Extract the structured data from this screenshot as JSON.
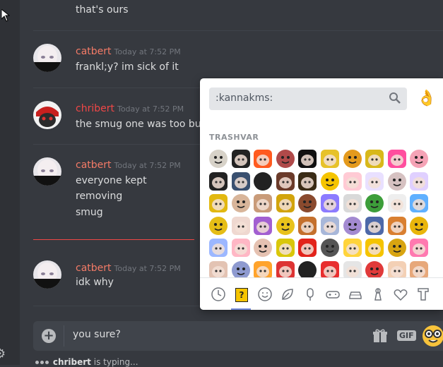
{
  "messages": [
    {
      "author": "",
      "time": "",
      "lines": [
        "that's ours"
      ]
    },
    {
      "author": "catbert",
      "time": "Today at 7:52 PM",
      "lines": [
        "frankl;y? im sick of it"
      ]
    },
    {
      "author": "chribert",
      "time": "Today at 7:52 PM",
      "lines": [
        "the smug one was too but it"
      ]
    },
    {
      "author": "catbert",
      "time": "Today at 7:52 PM",
      "lines": [
        "everyone kept",
        "removing",
        "smug"
      ]
    },
    {
      "author": "catbert",
      "time": "Today at 7:52 PM",
      "lines": [
        "idk why"
      ]
    }
  ],
  "composer": {
    "value": "you sure?",
    "gif_label": "GIF"
  },
  "typing": {
    "user": "chribert",
    "suffix": "is typing..."
  },
  "picker": {
    "search_value": ":kannakms:",
    "category_label": "TRASHVAR",
    "emoji_count_rows": 6
  },
  "colors": {
    "catbert": "#f47b67",
    "chribert": "#f04747",
    "accent": "#7289da"
  }
}
